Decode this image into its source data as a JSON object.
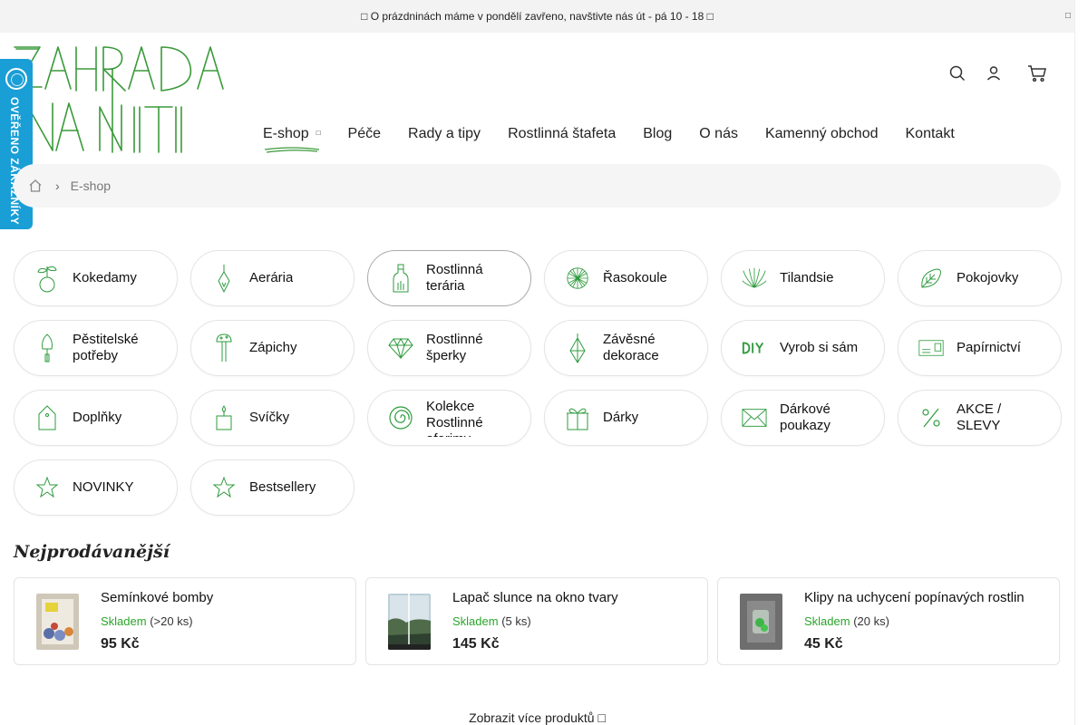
{
  "announcement": {
    "text": "□ O prázdninách máme v pondělí zavřeno, navštivte nás út - pá 10 - 18 □",
    "close_glyph": "□"
  },
  "badge": {
    "text": "OVĚŘENO ZÁKAZNÍKY",
    "color": "#1a9ed6"
  },
  "header": {
    "icons": [
      "search-icon",
      "user-icon",
      "cart-icon"
    ]
  },
  "nav": {
    "chevron_glyph": "□",
    "items": [
      "E-shop",
      "Péče",
      "Rady a tipy",
      "Rostlinná štafeta",
      "Blog",
      "O nás",
      "Kamenný obchod",
      "Kontakt"
    ]
  },
  "breadcrumb": {
    "separator": "›",
    "current": "E-shop"
  },
  "categories": [
    {
      "label": "Kokedamy",
      "icon": "kokedama-icon"
    },
    {
      "label": "Aerária",
      "icon": "aerarium-icon"
    },
    {
      "label": "Rostlinná terária",
      "icon": "terarium-bottle-icon"
    },
    {
      "label": "Řasokoule",
      "icon": "moss-ball-icon"
    },
    {
      "label": "Tilandsie",
      "icon": "tillandsia-icon"
    },
    {
      "label": "Pokojovky",
      "icon": "leaf-icon"
    },
    {
      "label": "Pěstitelské potřeby",
      "icon": "trowel-icon"
    },
    {
      "label": "Zápichy",
      "icon": "mushroom-stake-icon"
    },
    {
      "label": "Rostlinné šperky",
      "icon": "diamond-icon"
    },
    {
      "label": "Závěsné dekorace",
      "icon": "hanging-prism-icon"
    },
    {
      "label": "Vyrob si sám",
      "icon": "diy-icon"
    },
    {
      "label": "Papírnictví",
      "icon": "paper-card-icon"
    },
    {
      "label": "Doplňky",
      "icon": "house-tag-icon"
    },
    {
      "label": "Svíčky",
      "icon": "candle-icon"
    },
    {
      "label": "Kolekce Rostlinné aforimy",
      "icon": "spiral-icon"
    },
    {
      "label": "Dárky",
      "icon": "gift-icon"
    },
    {
      "label": "Dárkové poukazy",
      "icon": "envelope-icon"
    },
    {
      "label": "AKCE / SLEVY",
      "icon": "percent-icon"
    },
    {
      "label": "NOVINKY",
      "icon": "star-icon"
    },
    {
      "label": "Bestsellery",
      "icon": "star-icon"
    }
  ],
  "active_category": "Rostlinná terária",
  "bestsellers": {
    "title": "Nejprodávanější",
    "items": [
      {
        "name": "Semínkové bomby",
        "stock_label": "Skladem",
        "stock_qty": "(>20 ks)",
        "price": "95 Kč"
      },
      {
        "name": "Lapač slunce na okno tvary",
        "stock_label": "Skladem",
        "stock_qty": "(5 ks)",
        "price": "145 Kč"
      },
      {
        "name": "Klipy na uchycení popínavých rostlin",
        "stock_label": "Skladem",
        "stock_qty": "(20 ks)",
        "price": "45 Kč"
      }
    ]
  },
  "more_button": {
    "label": "Zobrazit více produktů □"
  },
  "colors": {
    "accent_green": "#2e9b3e",
    "stock_green": "#2aa52a",
    "badge_blue": "#1a9ed6"
  }
}
